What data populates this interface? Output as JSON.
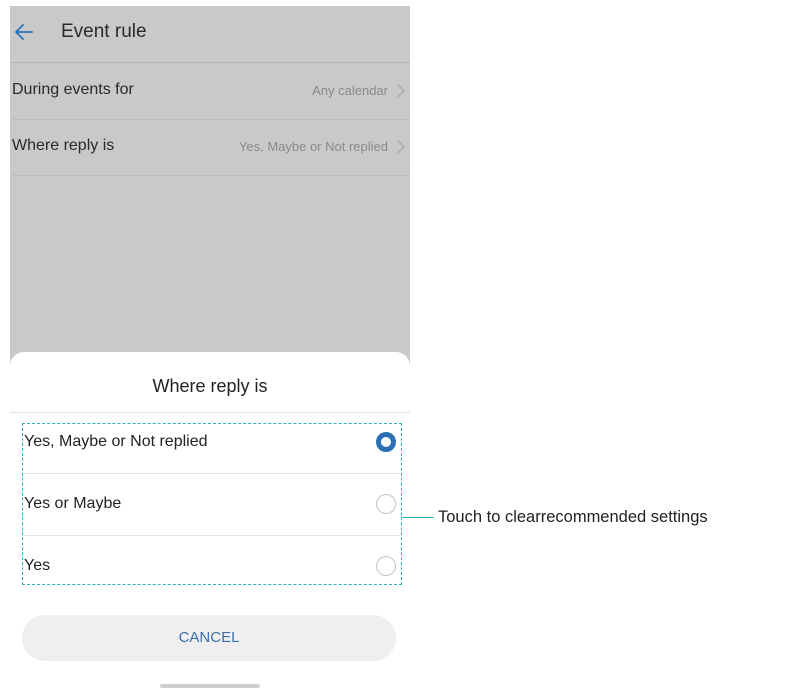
{
  "header": {
    "title": "Event rule",
    "back_icon": "arrow-left-icon"
  },
  "settings": [
    {
      "label": "During events for",
      "value": "Any calendar"
    },
    {
      "label": "Where reply is",
      "value": "Yes, Maybe or Not replied"
    }
  ],
  "dialog": {
    "title": "Where reply is",
    "options": [
      {
        "label": "Yes, Maybe or Not replied",
        "selected": true
      },
      {
        "label": "Yes or Maybe",
        "selected": false
      },
      {
        "label": "Yes",
        "selected": false
      }
    ],
    "cancel_label": "CANCEL"
  },
  "annotation": {
    "text": "Touch to clearrecommended settings"
  },
  "colors": {
    "accent": "#2b6fb5",
    "callout": "#2fb3b8",
    "overlay": "#c9c9c9"
  }
}
